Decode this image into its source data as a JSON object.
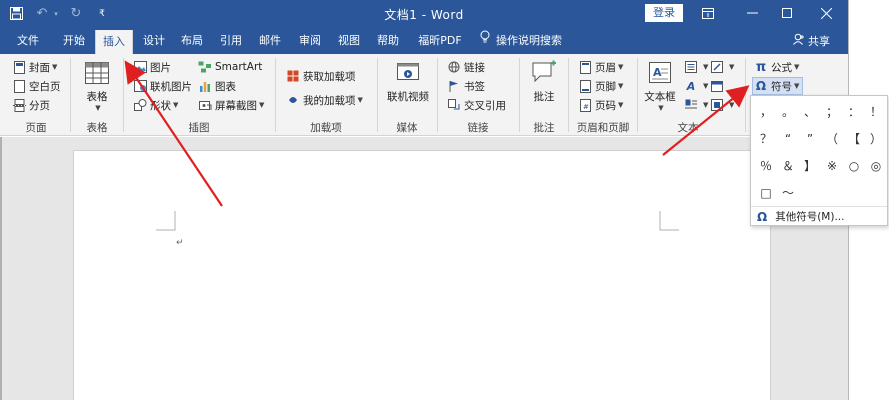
{
  "titlebar": {
    "doc_title": "文档1 - Word",
    "login_label": "登录",
    "bg_color": "#2b579a"
  },
  "tabs": [
    {
      "label": "文件"
    },
    {
      "label": "开始"
    },
    {
      "label": "插入"
    },
    {
      "label": "设计"
    },
    {
      "label": "布局"
    },
    {
      "label": "引用"
    },
    {
      "label": "邮件"
    },
    {
      "label": "审阅"
    },
    {
      "label": "视图"
    },
    {
      "label": "帮助"
    },
    {
      "label": "福昕PDF"
    }
  ],
  "tell_me": "操作说明搜索",
  "share_label": "共享",
  "ribbon": {
    "pages": {
      "cover": "封面",
      "blank": "空白页",
      "break": "分页",
      "group": "页面"
    },
    "table": {
      "label": "表格",
      "group": "表格"
    },
    "illustrations": {
      "picture": "图片",
      "online_picture": "联机图片",
      "shapes": "形状",
      "smartart": "SmartArt",
      "chart": "图表",
      "screenshot": "屏幕截图",
      "group": "插图"
    },
    "addins": {
      "get": "获取加载项",
      "my": "我的加载项",
      "group": "加载项"
    },
    "media": {
      "online_video": "联机视频",
      "group": "媒体"
    },
    "links": {
      "link": "链接",
      "bookmark": "书签",
      "cross_ref": "交叉引用",
      "group": "链接"
    },
    "comments": {
      "comment": "批注",
      "group": "批注"
    },
    "header_footer": {
      "header": "页眉",
      "footer": "页脚",
      "page_number": "页码",
      "group": "页眉和页脚"
    },
    "text": {
      "textbox": "文本框",
      "group": "文本"
    },
    "symbols": {
      "equation": "公式",
      "symbol": "符号",
      "pi": "π",
      "omega": "Ω"
    }
  },
  "symbol_panel": {
    "symbols": [
      "，",
      "。",
      "、",
      "；",
      "：",
      "！",
      "？",
      "“",
      "”",
      "（",
      "【",
      "）",
      "％",
      "＆",
      "】",
      "※",
      "○",
      "◎",
      "□",
      "～"
    ],
    "more_label": "其他符号(M)..."
  },
  "document": {
    "paragraph_mark": "↵"
  }
}
